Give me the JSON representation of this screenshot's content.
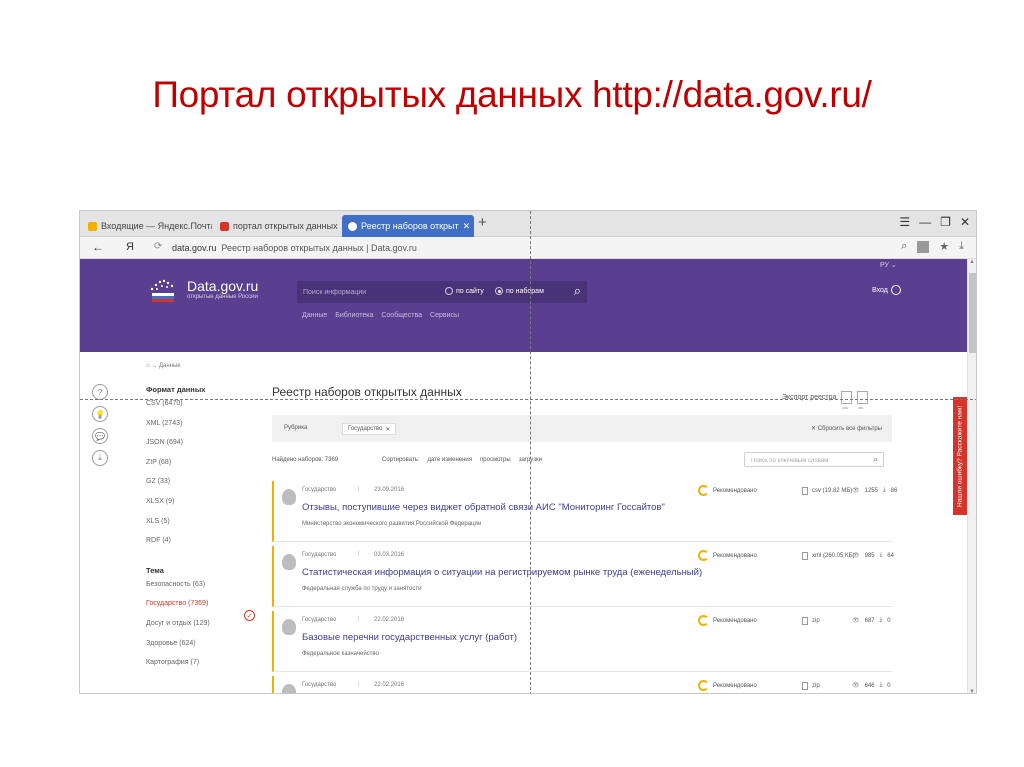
{
  "slide": {
    "title": "Портал открытых данных http://data.gov.ru/"
  },
  "browser": {
    "tabs": [
      {
        "label": "Входящие — Яндекс.Почта",
        "color": "#f2b100"
      },
      {
        "label": "портал открытых данных р",
        "color": "#d5342b"
      },
      {
        "label": "Реестр наборов открыт",
        "color": "#3f6fc7"
      }
    ],
    "new_tab": "+",
    "win_controls": [
      "☰",
      "—",
      "❐",
      "✕"
    ],
    "back": "←",
    "yandex": "Я",
    "reload": "⟳",
    "domain": "data.gov.ru",
    "page_title": "Реестр наборов открытых данных | Data.gov.ru",
    "star": "★",
    "download": "⤓",
    "bookmark_search": "⌕"
  },
  "site": {
    "logo_name": "Data.gov.ru",
    "logo_sub": "открытые данные России",
    "search_placeholder": "Поиск информации",
    "radio_site": "по сайту",
    "radio_sets": "по наборам",
    "search_button": "⌕",
    "nav": [
      "Данные",
      "Библиотека",
      "Сообщества",
      "Сервисы"
    ],
    "lang": "РУ ⌄",
    "login": "Вход"
  },
  "feedback": "Нашли ошибку? Расскажите нам!",
  "side_icons": [
    "?",
    "💡",
    "💬",
    "⤓"
  ],
  "breadcrumb": "⌂  →  Данные",
  "filters": {
    "format_heading": "Формат данных",
    "formats": [
      "CSV (6470)",
      "XML (2743)",
      "JSON (694)",
      "ZIP (68)",
      "GZ (33)",
      "XLSX (9)",
      "XLS (5)",
      "RDF (4)"
    ],
    "topic_heading": "Тема",
    "topics": [
      "Безопасность (63)",
      "Государство (7369)",
      "Досуг и отдых (129)",
      "Здоровье (624)",
      "Картография (7)"
    ],
    "selected_topic_index": 1,
    "check": "✓"
  },
  "main": {
    "title": "Реестр наборов открытых данных",
    "export_label": "Экспорт реестра",
    "export_formats": [
      "csv",
      "xls"
    ],
    "rubric_label": "Рубрика",
    "rubric_chip": "Государство",
    "chip_remove": "✕",
    "reset_filters": "✕  Сбросить все фильтры",
    "found": "Найдено наборов: 7369",
    "sort_label": "Сортировать:",
    "sort_options": [
      "дате изменения",
      "просмотры",
      "загрузки"
    ],
    "keyword_placeholder": "Поиск по ключевым словам",
    "keyword_icon": "⌕"
  },
  "datasets": [
    {
      "category": "Государство",
      "date": "23.09.2016",
      "title": "Отзывы, поступившие через виджет обратной связи АИС \"Мониторинг Госсайтов\"",
      "org": "Министерство экономического развития Российской Федерации",
      "badge": "Рекомендовано",
      "format": "csv (19.82 МБ)",
      "views": "1255",
      "downloads": "86"
    },
    {
      "category": "Государство",
      "date": "03.03.2016",
      "title": "Статистическая информация о ситуации на регистрируемом рынке труда (еженедельный)",
      "org": "Федеральная служба по труду и занятости",
      "badge": "Рекомендовано",
      "format": "xml (260.05 КБ)",
      "views": "985",
      "downloads": "64"
    },
    {
      "category": "Государство",
      "date": "22.02.2016",
      "title": "Базовые перечни государственных услуг (работ)",
      "org": "Федеральное казначейство",
      "badge": "Рекомендовано",
      "format": "zip",
      "views": "687",
      "downloads": "0"
    },
    {
      "category": "Государство",
      "date": "22.02.2016",
      "title": "",
      "org": "",
      "badge": "Рекомендовано",
      "format": "zip",
      "views": "646",
      "downloads": "0"
    }
  ],
  "colors": {
    "accent": "#5a3e8f",
    "title_red": "#c00000",
    "badge": "#f2b100",
    "link": "#3d3d8f"
  }
}
